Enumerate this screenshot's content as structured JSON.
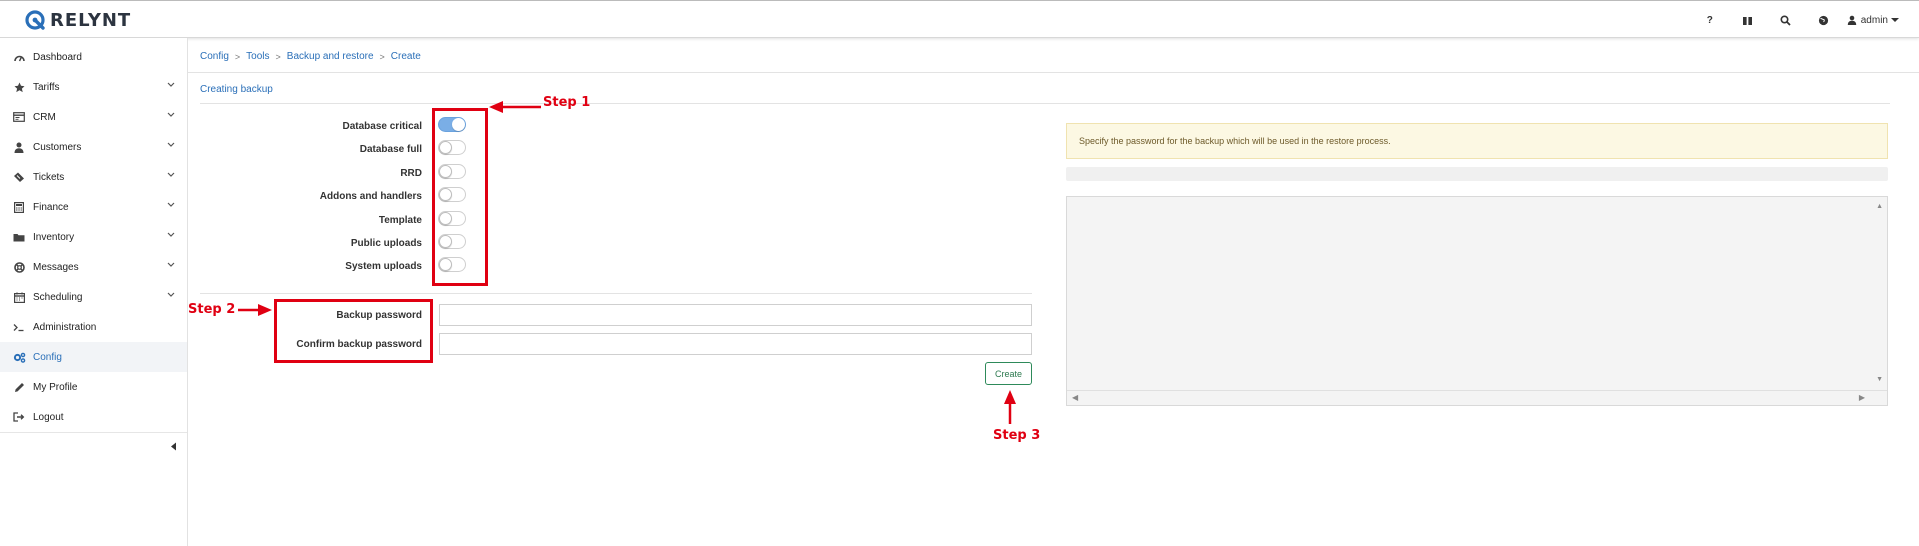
{
  "app": {
    "logo_text": "RELYNT"
  },
  "topbar": {
    "help_icon_glyph": "?",
    "user_label": "admin"
  },
  "sidebar": {
    "items": [
      {
        "label": "Dashboard",
        "icon": "dashboard-icon",
        "has_chevron": false
      },
      {
        "label": "Tariffs",
        "icon": "star-icon",
        "has_chevron": true
      },
      {
        "label": "CRM",
        "icon": "crm-card-icon",
        "has_chevron": true
      },
      {
        "label": "Customers",
        "icon": "user-icon",
        "has_chevron": true
      },
      {
        "label": "Tickets",
        "icon": "ticket-icon",
        "has_chevron": true
      },
      {
        "label": "Finance",
        "icon": "calculator-icon",
        "has_chevron": true
      },
      {
        "label": "Inventory",
        "icon": "folder-icon",
        "has_chevron": true
      },
      {
        "label": "Messages",
        "icon": "life-ring-icon",
        "has_chevron": true
      },
      {
        "label": "Scheduling",
        "icon": "calendar-icon",
        "has_chevron": true
      },
      {
        "label": "Administration",
        "icon": "terminal-icon",
        "has_chevron": false
      },
      {
        "label": "Config",
        "icon": "cogs-icon",
        "has_chevron": false,
        "active": true
      },
      {
        "label": "My Profile",
        "icon": "pencil-icon",
        "has_chevron": false
      },
      {
        "label": "Logout",
        "icon": "sign-out-icon",
        "has_chevron": false
      }
    ]
  },
  "breadcrumb": [
    "Config",
    "Tools",
    "Backup and restore",
    "Create"
  ],
  "panel": {
    "title": "Creating backup"
  },
  "options": [
    {
      "label": "Database critical",
      "checked": true
    },
    {
      "label": "Database full",
      "checked": false
    },
    {
      "label": "RRD",
      "checked": false
    },
    {
      "label": "Addons and handlers",
      "checked": false
    },
    {
      "label": "Template",
      "checked": false
    },
    {
      "label": "Public uploads",
      "checked": false
    },
    {
      "label": "System uploads",
      "checked": false
    }
  ],
  "password": {
    "label": "Backup password",
    "value": "",
    "confirm_label": "Confirm backup password",
    "confirm_value": ""
  },
  "create_button": "Create",
  "alert_text": "Specify the password for the backup which will be used in the restore process.",
  "annotations": {
    "step1": "Step 1",
    "step2": "Step 2",
    "step3": "Step 3"
  },
  "colors": {
    "accent": "#2a6fb8",
    "annotation": "#e00012",
    "create_border": "#2e8a5a",
    "alert_bg": "#fcf8e3",
    "toggle_on": "#7aaee6"
  }
}
